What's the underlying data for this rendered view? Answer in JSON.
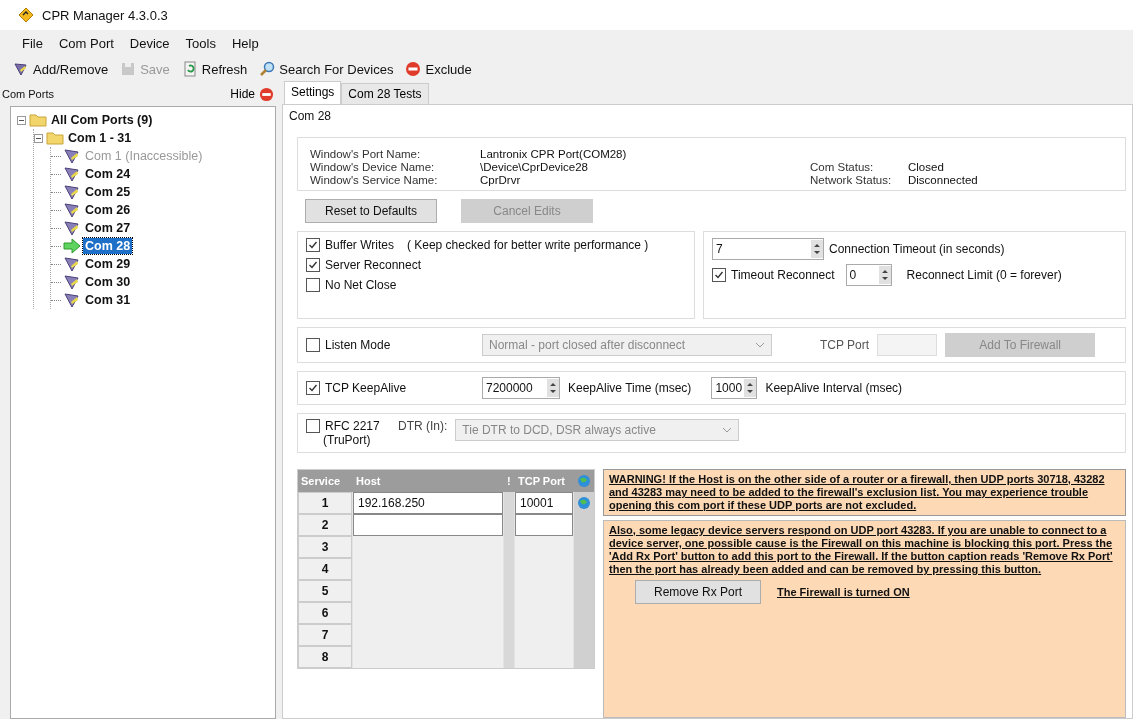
{
  "window": {
    "title": "CPR Manager 4.3.0.3"
  },
  "menu": [
    {
      "label": "File"
    },
    {
      "label": "Com Port"
    },
    {
      "label": "Device"
    },
    {
      "label": "Tools"
    },
    {
      "label": "Help"
    }
  ],
  "toolbar": [
    {
      "label": "Add/Remove",
      "kind": "addremove",
      "disabled": false
    },
    {
      "label": "Save",
      "kind": "save",
      "disabled": true
    },
    {
      "label": "Refresh",
      "kind": "refresh",
      "disabled": false
    },
    {
      "label": "Search For Devices",
      "kind": "search",
      "disabled": false
    },
    {
      "label": "Exclude",
      "kind": "exclude",
      "disabled": false
    }
  ],
  "sidebar": {
    "title": "Com Ports",
    "hide_label": "Hide",
    "tree": [
      {
        "label": "All Com Ports (9)",
        "expanded": true,
        "selected": false,
        "disabled": false,
        "children": [
          {
            "label": "Com 1 - 31",
            "expanded": true,
            "selected": false,
            "disabled": false,
            "children": [
              {
                "label": "Com 1 (Inaccessible)",
                "selected": false,
                "disabled": true
              },
              {
                "label": "Com 24",
                "selected": false,
                "disabled": false
              },
              {
                "label": "Com 25",
                "selected": false,
                "disabled": false
              },
              {
                "label": "Com 26",
                "selected": false,
                "disabled": false
              },
              {
                "label": "Com 27",
                "selected": false,
                "disabled": false
              },
              {
                "label": "Com 28",
                "selected": true,
                "disabled": false
              },
              {
                "label": "Com 29",
                "selected": false,
                "disabled": false
              },
              {
                "label": "Com 30",
                "selected": false,
                "disabled": false
              },
              {
                "label": "Com 31",
                "selected": false,
                "disabled": false
              }
            ]
          }
        ]
      }
    ]
  },
  "tabs": [
    {
      "label": "Settings",
      "selected": true
    },
    {
      "label": "Com 28 Tests",
      "selected": false
    }
  ],
  "group_title": "Com 28",
  "info": {
    "left": [
      {
        "label": "Window's Port Name:",
        "value": "Lantronix CPR Port(COM28)"
      },
      {
        "label": "Window's Device Name:",
        "value": "\\Device\\CprDevice28"
      },
      {
        "label": "Window's Service Name:",
        "value": "CprDrvr"
      }
    ],
    "right": [
      {
        "label": "Com Status:",
        "value": "Closed"
      },
      {
        "label": "Network Status:",
        "value": "Disconnected"
      }
    ]
  },
  "buttons": [
    {
      "label": "Reset to Defaults",
      "disabled": false
    },
    {
      "label": "Cancel Edits",
      "disabled": true
    }
  ],
  "options": [
    {
      "label": "Buffer Writes",
      "note": "( Keep checked for better write performance )",
      "checked": true
    },
    {
      "label": "Server Reconnect",
      "checked": true
    },
    {
      "label": "No Net Close",
      "checked": false
    }
  ],
  "timeout": {
    "value": "7",
    "label": "Connection Timeout (in seconds)"
  },
  "timeout_reconnect": {
    "label": "Timeout Reconnect",
    "checked": true,
    "value": "0",
    "limit_label": "Reconnect Limit (0 = forever)"
  },
  "listen": {
    "label": "Listen Mode",
    "checked": false,
    "mode": "Normal - port closed after disconnect",
    "tcp_port_label": "TCP Port",
    "firewall_button": "Add To Firewall",
    "disabled": true
  },
  "keepalive": {
    "label": "TCP KeepAlive",
    "checked": true,
    "time": "7200000",
    "time_label": "KeepAlive Time (msec)",
    "interval": "1000",
    "interval_label": "KeepAlive Interval (msec)"
  },
  "rfc": {
    "label": "RFC 2217",
    "sublabel": "(TruPort)",
    "checked": false,
    "dtr_label": "DTR (In):",
    "dtr_value": "Tie DTR to DCD, DSR always active"
  },
  "table": {
    "columns": [
      "Service",
      "Host",
      "!",
      "TCP Port"
    ],
    "rows": [
      {
        "service": "1",
        "host": "192.168.250",
        "port": "10001",
        "editable": true,
        "globe": true
      },
      {
        "service": "2",
        "editable": true,
        "globe": false
      },
      {
        "service": "3",
        "editable": false,
        "globe": false
      },
      {
        "service": "4",
        "editable": false,
        "globe": false
      },
      {
        "service": "5",
        "editable": false,
        "globe": false
      },
      {
        "service": "6",
        "editable": false,
        "globe": false
      },
      {
        "service": "7",
        "editable": false,
        "globe": false
      },
      {
        "service": "8",
        "editable": false,
        "globe": false
      }
    ]
  },
  "warning": "WARNING! If the Host is on the other side of a router or a firewall, then UDP ports 30718, 43282 and 43283 may need to be added to the firewall's exclusion list. You may experience trouble opening this com port if these UDP ports are not excluded.",
  "notice": "Also, some legacy device servers respond on UDP port 43283.  If you are unable to connect to a device server, one possible cause is the Firewall on this machine is blocking this port.  Press the 'Add Rx Port' button to add this port to the Firewall.  If the button caption reads 'Remove Rx Port' then the port has already been added and can be removed by pressing this button.",
  "rx_button": "Remove Rx Port",
  "firewall_status": "The Firewall is turned ON"
}
